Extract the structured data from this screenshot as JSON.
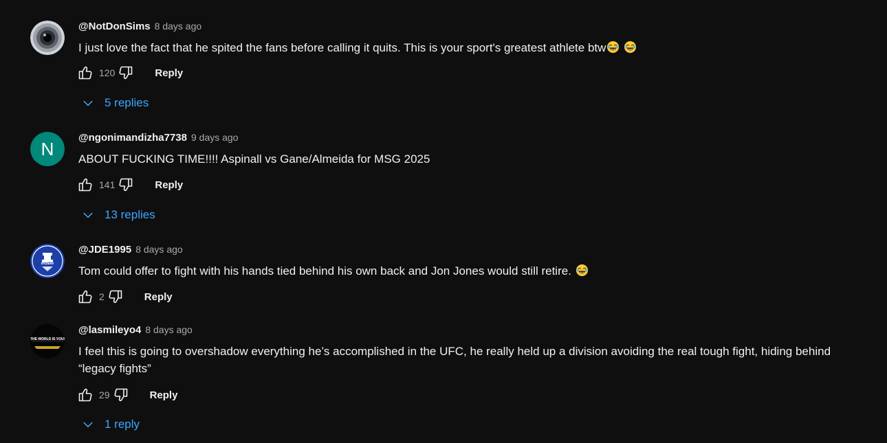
{
  "colors": {
    "background": "#0f0f0f",
    "text": "#f1f1f1",
    "muted": "#aaaaaa",
    "link": "#3ea6ff",
    "avatar_n": "#00897b",
    "everton_blue": "#1d3fa8"
  },
  "comments": [
    {
      "author": "@NotDonSims",
      "time": "8 days ago",
      "text": "I just love the fact that he spited the fans before calling it quits. This is your sport's greatest athlete btw",
      "emoji": [
        "laughing-tears-emoji",
        "laughing-tears-emoji"
      ],
      "likes": "120",
      "reply_label": "Reply",
      "replies_label": "5 replies",
      "avatar": "eye-avatar"
    },
    {
      "author": "@ngonimandizha7738",
      "time": "9 days ago",
      "text": "ABOUT FUCKING TIME!!!! Aspinall vs Gane/Almeida for MSG 2025",
      "emoji": [],
      "likes": "141",
      "reply_label": "Reply",
      "replies_label": "13 replies",
      "avatar_letter": "N"
    },
    {
      "author": "@JDE1995",
      "time": "8 days ago",
      "text": "Tom could offer to fight with his hands tied behind his own back and Jon Jones would still retire.",
      "emoji": [
        "laughing-tears-emoji"
      ],
      "likes": "2",
      "reply_label": "Reply",
      "avatar": "everton-crest-avatar",
      "avatar_text": "Everton"
    },
    {
      "author": "@lasmileyo4",
      "time": "8 days ago",
      "text": "I feel this is going to overshadow everything he’s accomplished in the UFC, he really held up a division avoiding the real tough fight, hiding behind “legacy fights”",
      "emoji": [],
      "likes": "29",
      "reply_label": "Reply",
      "replies_label": "1 reply",
      "avatar": "world-is-yours-avatar",
      "avatar_text": "THE WORLD IS YOURS"
    }
  ],
  "icons": {
    "like": "thumbs-up-icon",
    "dislike": "thumbs-down-icon",
    "expand": "chevron-down-icon"
  }
}
